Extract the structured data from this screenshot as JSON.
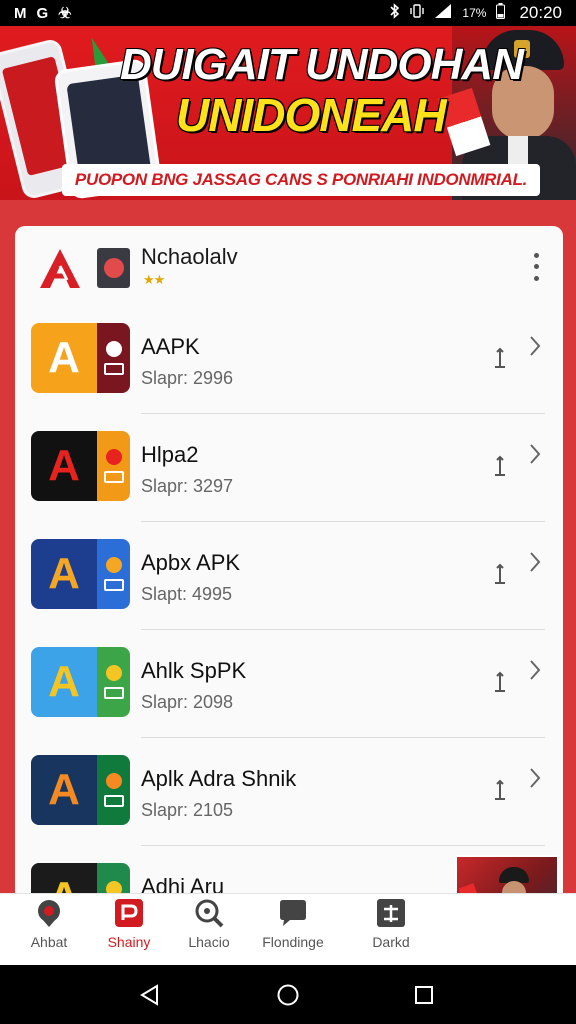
{
  "status_bar": {
    "left_icons": [
      "M",
      "G",
      "☣"
    ],
    "battery": "17%",
    "time": "20:20"
  },
  "banner": {
    "title_line1": "DUIGAIT UNDOHAN",
    "title_line2": "UNIDONEAH",
    "subtitle": "PUOPON BNG JASSAG CANS S PONRIAHI INDONMRIAL."
  },
  "header": {
    "title": "Nchaolalv",
    "stars": "★★"
  },
  "apps": [
    {
      "name": "AAPK",
      "size": "Slapr: 2996",
      "icon_letter": "A",
      "icon_bg": "#f7a21b",
      "icon_side_bg": "#7a1620",
      "icon_letter_color": "#ffffff"
    },
    {
      "name": "Hlpa2",
      "size": "Slapr: 3297",
      "icon_letter": "A",
      "icon_bg": "#111111",
      "icon_side_bg": "#f29a18",
      "icon_letter_color": "#e8221f"
    },
    {
      "name": "Apbx APK",
      "size": "Slapt: 4995",
      "icon_letter": "A",
      "icon_bg": "#1d3d8f",
      "icon_side_bg": "#2b6ed8",
      "icon_letter_color": "#f5a623"
    },
    {
      "name": "Ahlk SpPK",
      "size": "Slapr: 2098",
      "icon_letter": "A",
      "icon_bg": "#3da3e8",
      "icon_side_bg": "#3ca548",
      "icon_letter_color": "#f5c623"
    },
    {
      "name": "Aplk Adra Shnik",
      "size": "Slapr: 2105",
      "icon_letter": "A",
      "icon_bg": "#17355f",
      "icon_side_bg": "#0f7a3b",
      "icon_letter_color": "#f58a23"
    },
    {
      "name": "Adhi Aru",
      "size": "",
      "icon_letter": "A",
      "icon_bg": "#1b1b1b",
      "icon_side_bg": "#1f8a4b",
      "icon_letter_color": "#f5c623"
    }
  ],
  "bottom_nav": [
    {
      "label": "Ahbat",
      "icon": "location-icon",
      "active": false
    },
    {
      "label": "Shainy",
      "icon": "shop-icon",
      "active": true
    },
    {
      "label": "Lhacio",
      "icon": "search-icon",
      "active": false
    },
    {
      "label": "Flondinge",
      "icon": "chat-icon",
      "active": false
    },
    {
      "label": "Darkd",
      "icon": "plus-box-icon",
      "active": false
    }
  ],
  "colors": {
    "accent": "#d11b20",
    "background": "#d9383a",
    "banner_title2": "#ffe21a"
  }
}
